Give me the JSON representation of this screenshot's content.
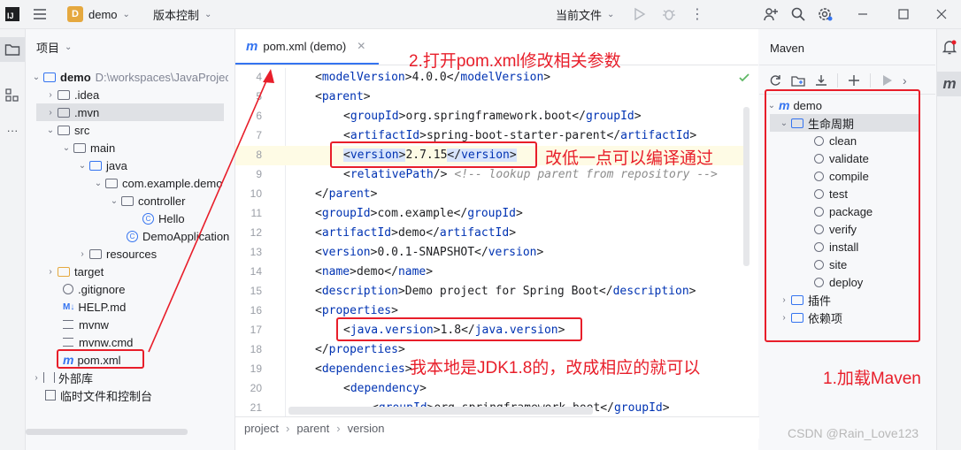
{
  "titlebar": {
    "app_badge": "D",
    "project_name": "demo",
    "vcs_label": "版本控制",
    "run_config": "当前文件"
  },
  "project_panel": {
    "title": "项目",
    "root_name": "demo",
    "root_path": "D:\\workspaces\\JavaProjects",
    "items": [
      {
        "label": ".idea"
      },
      {
        "label": ".mvn"
      },
      {
        "label": "src"
      },
      {
        "label": "main"
      },
      {
        "label": "java"
      },
      {
        "label": "com.example.demo"
      },
      {
        "label": "controller"
      },
      {
        "label": "Hello"
      },
      {
        "label": "DemoApplication"
      },
      {
        "label": "resources"
      },
      {
        "label": "target"
      },
      {
        "label": ".gitignore"
      },
      {
        "label": "HELP.md"
      },
      {
        "label": "mvnw"
      },
      {
        "label": "mvnw.cmd"
      },
      {
        "label": "pom.xml"
      },
      {
        "label": "外部库"
      },
      {
        "label": "临时文件和控制台"
      }
    ],
    "md_badge": "M↓"
  },
  "editor": {
    "tab_label": "pom.xml (demo)",
    "lines": [
      {
        "num": "4",
        "content": "<modelVersion>4.0.0</modelVersion>"
      },
      {
        "num": "5",
        "content": "<parent>"
      },
      {
        "num": "6",
        "content": "<groupId>org.springframework.boot</groupId>"
      },
      {
        "num": "7",
        "content": "<artifactId>spring-boot-starter-parent</artifactId>"
      },
      {
        "num": "8",
        "content": "<version>2.7.15</version>"
      },
      {
        "num": "9",
        "content": "<relativePath/>"
      },
      {
        "num": "10",
        "content": "</parent>"
      },
      {
        "num": "11",
        "content": "<groupId>com.example</groupId>"
      },
      {
        "num": "12",
        "content": "<artifactId>demo</artifactId>"
      },
      {
        "num": "13",
        "content": "<version>0.0.1-SNAPSHOT</version>"
      },
      {
        "num": "14",
        "content": "<name>demo</name>"
      },
      {
        "num": "15",
        "content": "<description>Demo project for Spring Boot</description>"
      },
      {
        "num": "16",
        "content": "<properties>"
      },
      {
        "num": "17",
        "content": "<java.version>1.8</java.version>"
      },
      {
        "num": "18",
        "content": "</properties>"
      },
      {
        "num": "19",
        "content": "<dependencies>"
      },
      {
        "num": "20",
        "content": "<dependency>"
      },
      {
        "num": "21",
        "content": "<groupId>org.springframework.boot</groupId>"
      }
    ],
    "comment": "<!-- lookup parent from repository -->",
    "breadcrumb": [
      "project",
      "parent",
      "version"
    ]
  },
  "maven": {
    "title": "Maven",
    "root": "demo",
    "lifecycle_label": "生命周期",
    "phases": [
      "clean",
      "validate",
      "compile",
      "test",
      "package",
      "verify",
      "install",
      "site",
      "deploy"
    ],
    "plugins_label": "插件",
    "deps_label": "依赖项"
  },
  "annotations": {
    "open_pom": "2.打开pom.xml修改相关参数",
    "lower_version": "改低一点可以编译通过",
    "jdk_note": "我本地是JDK1.8的，改成相应的就可以",
    "load_maven": "1.加载Maven"
  },
  "watermark": "CSDN @Rain_Love123",
  "colors": {
    "accent": "#3574f0",
    "annotation_red": "#e81e2a",
    "xml_tag": "#0033b3"
  }
}
